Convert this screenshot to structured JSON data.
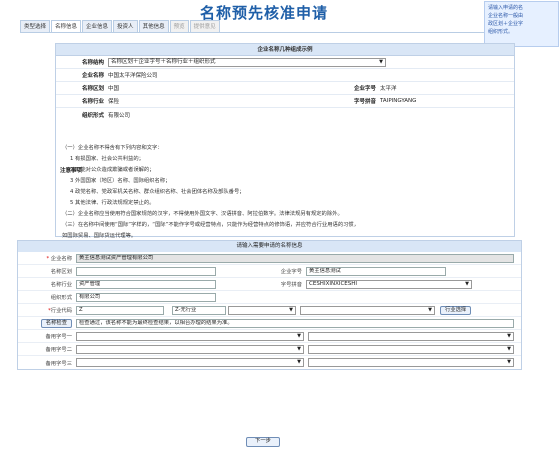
{
  "page": {
    "title": "名称预先核准申请"
  },
  "tabs": [
    {
      "label": "类型选择",
      "state": "normal"
    },
    {
      "label": "名称信息",
      "state": "active"
    },
    {
      "label": "企业信息",
      "state": "normal"
    },
    {
      "label": "投资人",
      "state": "normal"
    },
    {
      "label": "其他信息",
      "state": "normal"
    },
    {
      "label": "预览",
      "state": "disabled"
    },
    {
      "label": "提供意见",
      "state": "disabled"
    }
  ],
  "side_note": {
    "lines": [
      "请输入申请的名",
      "企业名称一般由",
      "政区划＋企业字",
      "组织形式。"
    ]
  },
  "example": {
    "header": "企业名称几种组成示例",
    "structure_label": "名称结构",
    "structure_value": "名称区划＋企业字号＋名称行业＋组织形式",
    "name_label": "企业名称",
    "name_value": "中国太平洋保险公司",
    "region_label": "名称区划",
    "region_value": "中国",
    "brand_label": "企业字号",
    "brand_value": "太平洋",
    "industry_label": "名称行业",
    "industry_value": "保险",
    "pinyin_label": "字号拼音",
    "pinyin_value": "TAIPINGYANG",
    "form_label": "组织形式",
    "form_value": "有限公司"
  },
  "notice": {
    "label": "注意事项",
    "lines": [
      "（一）企业名称不得含有下列内容和文字：",
      "1 有损国家、社会公共利益的；",
      "2 可能对公众造成欺骗或者误解的；",
      "3 外国国家（地区）名称、国际组织名称；",
      "4 政党名称、党政军机关名称、群众组织名称、社会团体名称及部队番号；",
      "5 其他法律、行政法规规定禁止的。",
      "（二）企业名称应当使用符合国家规范的汉字，不得使用外国文字、汉语拼音、阿拉伯数字。法律法规另有规定的除外。",
      "（三）在名称中间使用“国际”字样的，“国际”不能作字号或经营特点，只能作为经营特点的修饰语，并应符合行业用语的习惯，",
      "如国际贸易、国际货运代理等。"
    ]
  },
  "form": {
    "header": "请输入需要申请的名称信息",
    "company_name_label": "企业名称",
    "company_name_value": "黄主信息测试资产管理有限公司",
    "region_label": "名称区划",
    "region_value": "",
    "brand_label": "企业字号",
    "brand_value": "黄主信息测试",
    "industry_label": "名称行业",
    "industry_value": "资产管理",
    "pinyin_label": "字号拼音",
    "pinyin_value": "CESHIXINXICESHI",
    "org_form_label": "组织形式",
    "org_form_value": "有限公司",
    "industry_code_label": "行业代码",
    "industry_code_value": "Z",
    "industry_code_desc": "Z-无行业",
    "industry_select_button": "行业选择",
    "name_check_button": "名称检查",
    "name_check_result": "检查通过，该名称不能为最终检查结果，以相台办理的结果为准。",
    "alt1_label": "备用字号一",
    "alt2_label": "备用字号二",
    "alt3_label": "备用字号三",
    "next_button": "下一步"
  }
}
